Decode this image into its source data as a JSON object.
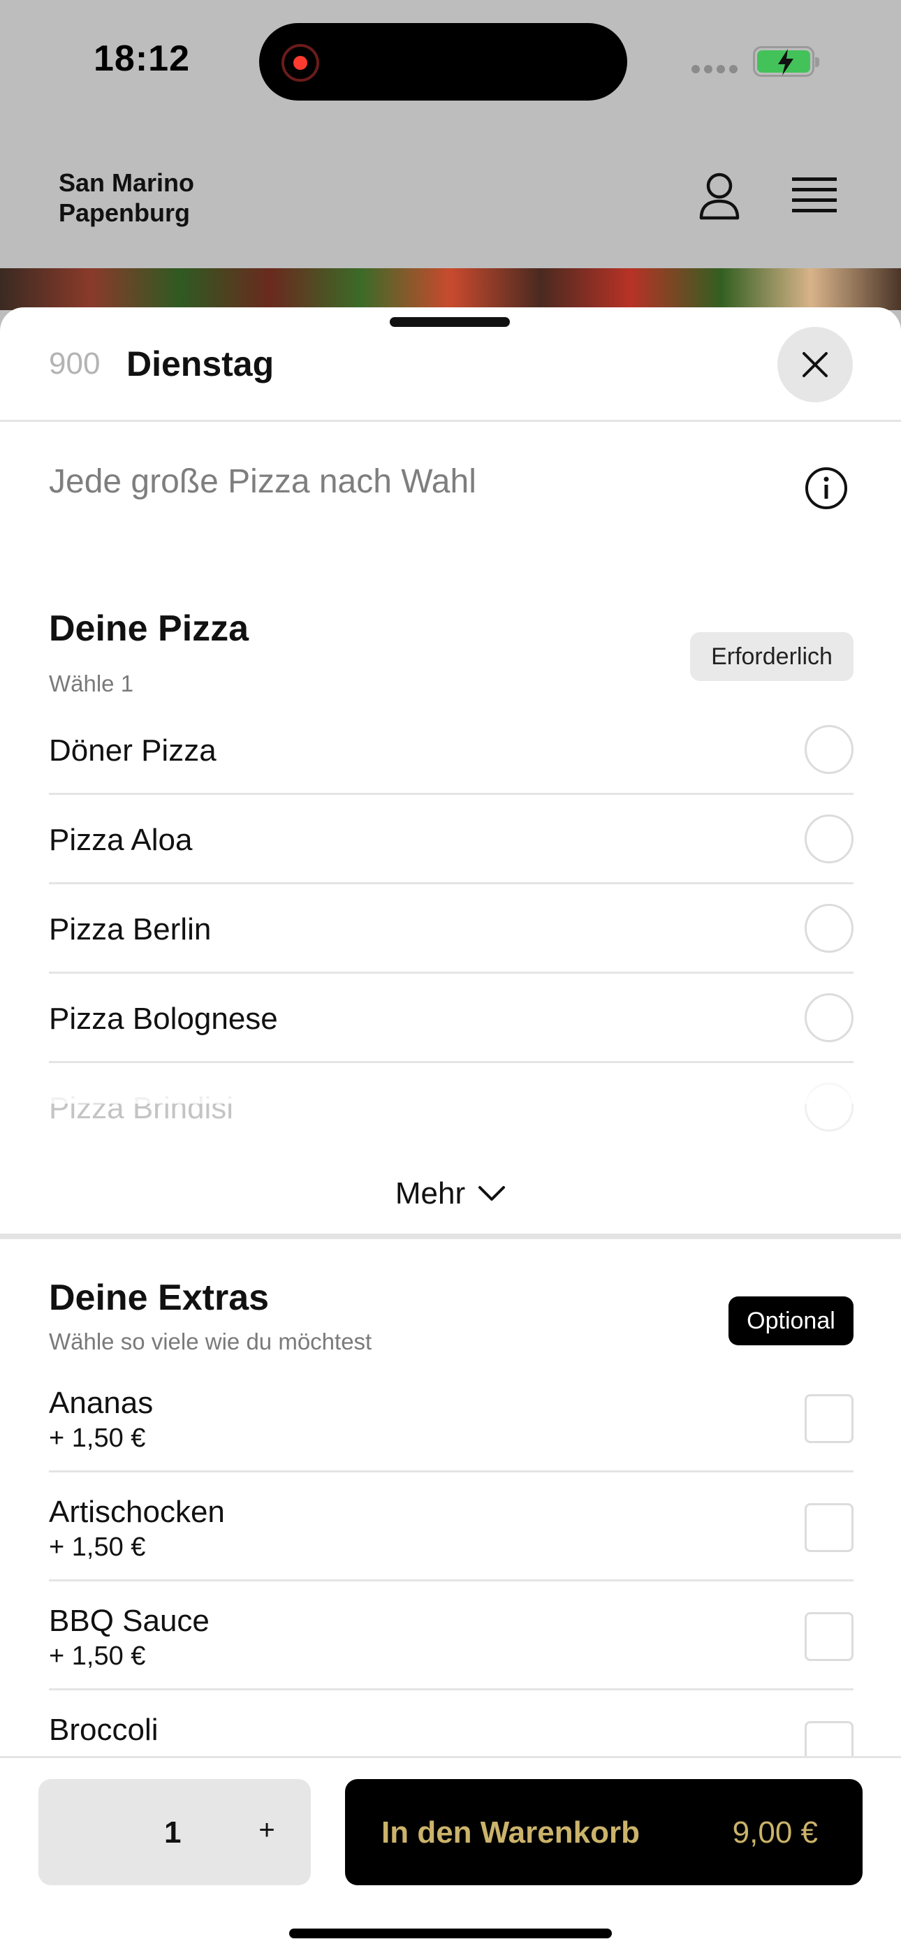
{
  "status_bar": {
    "time": "18:12"
  },
  "header": {
    "brand_line1": "San Marino",
    "brand_line2": "Papenburg"
  },
  "sheet": {
    "item_number": "900",
    "title": "Dienstag",
    "description": "Jede große Pizza nach Wahl"
  },
  "pizza_section": {
    "title": "Deine Pizza",
    "subtitle": "Wähle 1",
    "badge": "Erforderlich",
    "options": [
      {
        "label": "Döner Pizza"
      },
      {
        "label": "Pizza Aloa"
      },
      {
        "label": "Pizza Berlin"
      },
      {
        "label": "Pizza Bolognese"
      },
      {
        "label": "Pizza Brindisi"
      }
    ],
    "more_label": "Mehr"
  },
  "extras_section": {
    "title": "Deine Extras",
    "subtitle": "Wähle so viele wie du möchtest",
    "badge": "Optional",
    "items": [
      {
        "label": "Ananas",
        "price": "+ 1,50 €"
      },
      {
        "label": "Artischocken",
        "price": "+ 1,50 €"
      },
      {
        "label": "BBQ Sauce",
        "price": "+ 1,50 €"
      },
      {
        "label": "Broccoli",
        "price": ""
      }
    ]
  },
  "bottom_bar": {
    "quantity": "1",
    "plus_label": "+",
    "cart_label": "In den Warenkorb",
    "cart_price": "9,00 €"
  },
  "colors": {
    "accent_gold": "#cbb36b",
    "battery_green": "#43c25a",
    "record_red": "#ff3b30"
  }
}
